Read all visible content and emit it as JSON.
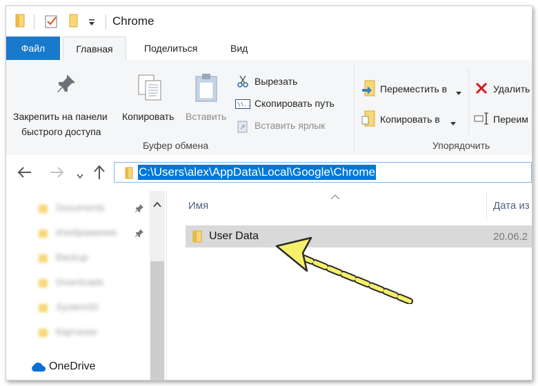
{
  "window": {
    "title": "Chrome"
  },
  "tabs": [
    {
      "label": "Файл"
    },
    {
      "label": "Главная"
    },
    {
      "label": "Поделиться"
    },
    {
      "label": "Вид"
    }
  ],
  "ribbon": {
    "pin_line1": "Закрепить на панели",
    "pin_line2": "быстрого доступа",
    "copy": "Копировать",
    "paste": "Вставить",
    "cut": "Вырезать",
    "copy_path": "Скопировать путь",
    "paste_shortcut": "Вставить ярлык",
    "clipboard_group": "Буфер обмена",
    "move_to": "Переместить в",
    "copy_to": "Копировать в",
    "delete": "Удалить",
    "rename": "Переим",
    "organize_group": "Упорядочить"
  },
  "address": {
    "path": "C:\\Users\\alex\\AppData\\Local\\Google\\Chrome"
  },
  "nav_pane": {
    "items": [
      {
        "label": "Documents"
      },
      {
        "label": "Изображения"
      },
      {
        "label": "Backup"
      },
      {
        "label": "Downloads"
      },
      {
        "label": "System32"
      },
      {
        "label": "Картинки"
      }
    ],
    "onedrive": "OneDrive"
  },
  "content": {
    "col_name": "Имя",
    "col_date": "Дата из",
    "rows": [
      {
        "name": "User Data",
        "date": "20.06.2"
      }
    ]
  },
  "colors": {
    "accent": "#1979ca",
    "selection": "#0078d7",
    "folder": "#f8d775",
    "arrow": "#f5f06a"
  }
}
